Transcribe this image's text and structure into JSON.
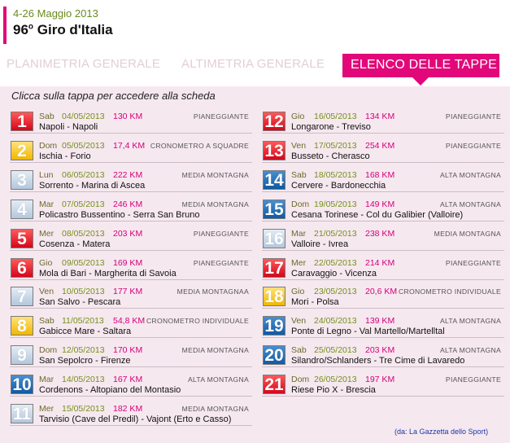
{
  "header": {
    "dates": "4-26 Maggio 2013",
    "title_number": "96",
    "title_sup": "o",
    "title_rest": " Giro d'Italia"
  },
  "tabs": [
    {
      "label": "PLANIMETRIA GENERALE"
    },
    {
      "label": "ALTIMETRIA GENERALE"
    },
    {
      "label": "ELENCO DELLE TAPPE"
    }
  ],
  "instructions": "Clicca sulla tappa per accedere alla scheda",
  "colors": {
    "accent": "#e2087a",
    "date_green": "#74901a",
    "km_magenta": "#d4007b",
    "source_blue": "#1a37a8"
  },
  "stages": [
    {
      "num": "1",
      "dow": "Sab",
      "date": "04/05/2013",
      "km": "130 KM",
      "type": "PIANEGGIANTE",
      "route": "Napoli - Napoli",
      "color": "red"
    },
    {
      "num": "2",
      "dow": "Dom",
      "date": "05/05/2013",
      "km": "17,4 KM",
      "type": "CRONOMETRO A SQUADRE",
      "route": "Ischia - Forio",
      "color": "yellow"
    },
    {
      "num": "3",
      "dow": "Lun",
      "date": "06/05/2013",
      "km": "222 KM",
      "type": "MEDIA MONTAGNA",
      "route": "Sorrento - Marina di Ascea",
      "color": "lblue"
    },
    {
      "num": "4",
      "dow": "Mar",
      "date": "07/05/2013",
      "km": "246 KM",
      "type": "MEDIA MONTAGNA",
      "route": "Policastro Bussentino - Serra San Bruno",
      "color": "lblue"
    },
    {
      "num": "5",
      "dow": "Mer",
      "date": "08/05/2013",
      "km": "203 KM",
      "type": "PIANEGGIANTE",
      "route": "Cosenza - Matera",
      "color": "red"
    },
    {
      "num": "6",
      "dow": "Gio",
      "date": "09/05/2013",
      "km": "169 KM",
      "type": "PIANEGGIANTE",
      "route": "Mola di Bari - Margherita di Savoia",
      "color": "red"
    },
    {
      "num": "7",
      "dow": "Ven",
      "date": "10/05/2013",
      "km": "177 KM",
      "type": "MEDIA MONTAGNAA",
      "route": "San Salvo - Pescara",
      "color": "lblue"
    },
    {
      "num": "8",
      "dow": "Sab",
      "date": "11/05/2013",
      "km": "54,8 KM",
      "type": "CRONOMETRO INDIVIDUALE",
      "route": "Gabicce Mare - Saltara",
      "color": "yellow"
    },
    {
      "num": "9",
      "dow": "Dom",
      "date": "12/05/2013",
      "km": "170 KM",
      "type": "MEDIA MONTAGNA",
      "route": "San Sepolcro - Firenze",
      "color": "lblue"
    },
    {
      "num": "10",
      "dow": "Mar",
      "date": "14/05/2013",
      "km": "167 KM",
      "type": "ALTA MONTAGNA",
      "route": "Cordenons - Altopiano del Montasio",
      "color": "dblue"
    },
    {
      "num": "11",
      "dow": "Mer",
      "date": "15/05/2013",
      "km": "182 KM",
      "type": "MEDIA MONTAGNA",
      "route": "Tarvisio (Cave del Predil) - Vajont (Erto e Casso)",
      "color": "lblue"
    },
    {
      "num": "12",
      "dow": "Gio",
      "date": "16/05/2013",
      "km": "134 KM",
      "type": "PIANEGGIANTE",
      "route": "Longarone - Treviso",
      "color": "red"
    },
    {
      "num": "13",
      "dow": "Ven",
      "date": "17/05/2013",
      "km": "254 KM",
      "type": "PIANEGGIANTE",
      "route": "Busseto - Cherasco",
      "color": "red"
    },
    {
      "num": "14",
      "dow": "Sab",
      "date": "18/05/2013",
      "km": "168 KM",
      "type": "ALTA MONTAGNA",
      "route": "Cervere - Bardonecchia",
      "color": "dblue"
    },
    {
      "num": "15",
      "dow": "Dom",
      "date": "19/05/2013",
      "km": "149 KM",
      "type": "ALTA MONTAGNA",
      "route": "Cesana Torinese - Col du Galibier (Valloire)",
      "color": "dblue"
    },
    {
      "num": "16",
      "dow": "Mar",
      "date": "21/05/2013",
      "km": "238 KM",
      "type": "MEDIA MONTAGNA",
      "route": "Valloire - Ivrea",
      "color": "lblue"
    },
    {
      "num": "17",
      "dow": "Mer",
      "date": "22/05/2013",
      "km": "214 KM",
      "type": "PIANEGGIANTE",
      "route": "Caravaggio - Vicenza",
      "color": "red"
    },
    {
      "num": "18",
      "dow": "Gio",
      "date": "23/05/2013",
      "km": "20,6 KM",
      "type": "CRONOMETRO INDIVIDUALE",
      "route": "Mori - Polsa",
      "color": "yellow"
    },
    {
      "num": "19",
      "dow": "Ven",
      "date": "24/05/2013",
      "km": "139 KM",
      "type": "ALTA MONTAGNA",
      "route": "Ponte di Legno - Val Martello/Martelltal",
      "color": "dblue"
    },
    {
      "num": "20",
      "dow": "Sab",
      "date": "25/05/2013",
      "km": "203 KM",
      "type": "ALTA MONTAGNA",
      "route": "Silandro/Schlanders - Tre Cime di Lavaredo",
      "color": "dblue"
    },
    {
      "num": "21",
      "dow": "Dom",
      "date": "26/05/2013",
      "km": "197 KM",
      "type": "PIANEGGIANTE",
      "route": "Riese Pio X - Brescia",
      "color": "red"
    }
  ],
  "source": "(da: La Gazzetta dello Sport)"
}
